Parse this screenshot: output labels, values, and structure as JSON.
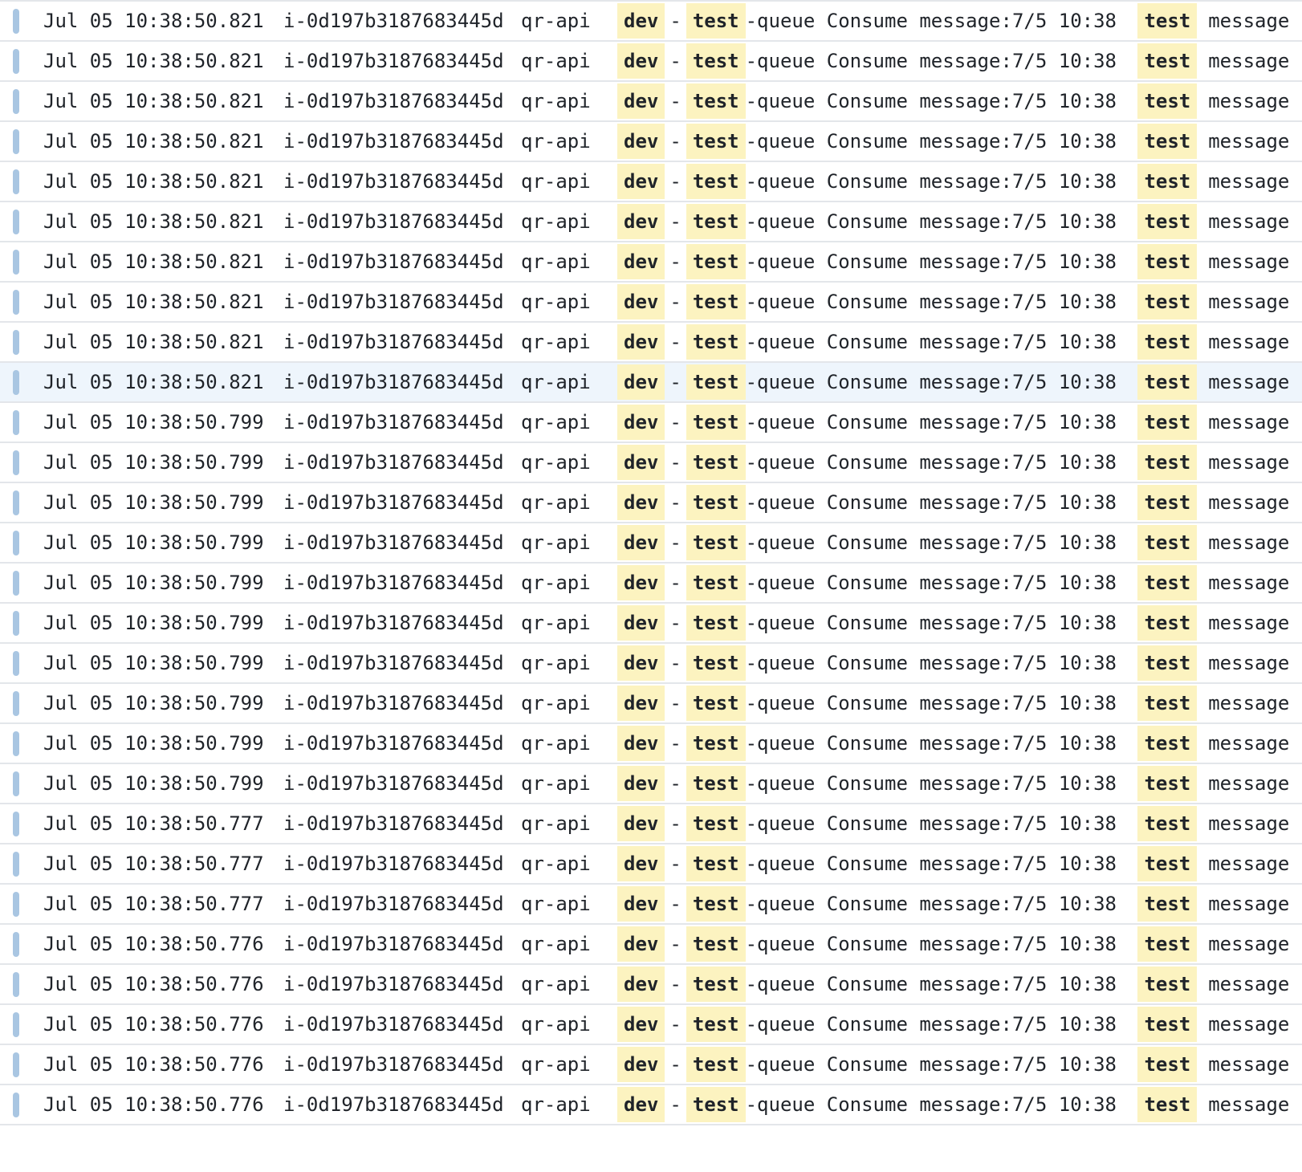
{
  "colors": {
    "marker": "#a9c6e2",
    "highlight": "#fcf3c0",
    "selected_row": "#eef5fc",
    "text": "#1f2329",
    "divider": "#e3e6ea"
  },
  "highlight_terms": [
    "dev",
    "test"
  ],
  "selected_index": 9,
  "logs": [
    {
      "time": "Jul 05 10:38:50.821",
      "instance": "i-0d197b3187683445d",
      "service": "qr-api",
      "message": "dev-test-queue Consume message:7/5 10:38 test message"
    },
    {
      "time": "Jul 05 10:38:50.821",
      "instance": "i-0d197b3187683445d",
      "service": "qr-api",
      "message": "dev-test-queue Consume message:7/5 10:38 test message"
    },
    {
      "time": "Jul 05 10:38:50.821",
      "instance": "i-0d197b3187683445d",
      "service": "qr-api",
      "message": "dev-test-queue Consume message:7/5 10:38 test message"
    },
    {
      "time": "Jul 05 10:38:50.821",
      "instance": "i-0d197b3187683445d",
      "service": "qr-api",
      "message": "dev-test-queue Consume message:7/5 10:38 test message"
    },
    {
      "time": "Jul 05 10:38:50.821",
      "instance": "i-0d197b3187683445d",
      "service": "qr-api",
      "message": "dev-test-queue Consume message:7/5 10:38 test message"
    },
    {
      "time": "Jul 05 10:38:50.821",
      "instance": "i-0d197b3187683445d",
      "service": "qr-api",
      "message": "dev-test-queue Consume message:7/5 10:38 test message"
    },
    {
      "time": "Jul 05 10:38:50.821",
      "instance": "i-0d197b3187683445d",
      "service": "qr-api",
      "message": "dev-test-queue Consume message:7/5 10:38 test message"
    },
    {
      "time": "Jul 05 10:38:50.821",
      "instance": "i-0d197b3187683445d",
      "service": "qr-api",
      "message": "dev-test-queue Consume message:7/5 10:38 test message"
    },
    {
      "time": "Jul 05 10:38:50.821",
      "instance": "i-0d197b3187683445d",
      "service": "qr-api",
      "message": "dev-test-queue Consume message:7/5 10:38 test message"
    },
    {
      "time": "Jul 05 10:38:50.821",
      "instance": "i-0d197b3187683445d",
      "service": "qr-api",
      "message": "dev-test-queue Consume message:7/5 10:38 test message"
    },
    {
      "time": "Jul 05 10:38:50.799",
      "instance": "i-0d197b3187683445d",
      "service": "qr-api",
      "message": "dev-test-queue Consume message:7/5 10:38 test message"
    },
    {
      "time": "Jul 05 10:38:50.799",
      "instance": "i-0d197b3187683445d",
      "service": "qr-api",
      "message": "dev-test-queue Consume message:7/5 10:38 test message"
    },
    {
      "time": "Jul 05 10:38:50.799",
      "instance": "i-0d197b3187683445d",
      "service": "qr-api",
      "message": "dev-test-queue Consume message:7/5 10:38 test message"
    },
    {
      "time": "Jul 05 10:38:50.799",
      "instance": "i-0d197b3187683445d",
      "service": "qr-api",
      "message": "dev-test-queue Consume message:7/5 10:38 test message"
    },
    {
      "time": "Jul 05 10:38:50.799",
      "instance": "i-0d197b3187683445d",
      "service": "qr-api",
      "message": "dev-test-queue Consume message:7/5 10:38 test message"
    },
    {
      "time": "Jul 05 10:38:50.799",
      "instance": "i-0d197b3187683445d",
      "service": "qr-api",
      "message": "dev-test-queue Consume message:7/5 10:38 test message"
    },
    {
      "time": "Jul 05 10:38:50.799",
      "instance": "i-0d197b3187683445d",
      "service": "qr-api",
      "message": "dev-test-queue Consume message:7/5 10:38 test message"
    },
    {
      "time": "Jul 05 10:38:50.799",
      "instance": "i-0d197b3187683445d",
      "service": "qr-api",
      "message": "dev-test-queue Consume message:7/5 10:38 test message"
    },
    {
      "time": "Jul 05 10:38:50.799",
      "instance": "i-0d197b3187683445d",
      "service": "qr-api",
      "message": "dev-test-queue Consume message:7/5 10:38 test message"
    },
    {
      "time": "Jul 05 10:38:50.799",
      "instance": "i-0d197b3187683445d",
      "service": "qr-api",
      "message": "dev-test-queue Consume message:7/5 10:38 test message"
    },
    {
      "time": "Jul 05 10:38:50.777",
      "instance": "i-0d197b3187683445d",
      "service": "qr-api",
      "message": "dev-test-queue Consume message:7/5 10:38 test message"
    },
    {
      "time": "Jul 05 10:38:50.777",
      "instance": "i-0d197b3187683445d",
      "service": "qr-api",
      "message": "dev-test-queue Consume message:7/5 10:38 test message"
    },
    {
      "time": "Jul 05 10:38:50.777",
      "instance": "i-0d197b3187683445d",
      "service": "qr-api",
      "message": "dev-test-queue Consume message:7/5 10:38 test message"
    },
    {
      "time": "Jul 05 10:38:50.776",
      "instance": "i-0d197b3187683445d",
      "service": "qr-api",
      "message": "dev-test-queue Consume message:7/5 10:38 test message"
    },
    {
      "time": "Jul 05 10:38:50.776",
      "instance": "i-0d197b3187683445d",
      "service": "qr-api",
      "message": "dev-test-queue Consume message:7/5 10:38 test message"
    },
    {
      "time": "Jul 05 10:38:50.776",
      "instance": "i-0d197b3187683445d",
      "service": "qr-api",
      "message": "dev-test-queue Consume message:7/5 10:38 test message"
    },
    {
      "time": "Jul 05 10:38:50.776",
      "instance": "i-0d197b3187683445d",
      "service": "qr-api",
      "message": "dev-test-queue Consume message:7/5 10:38 test message"
    },
    {
      "time": "Jul 05 10:38:50.776",
      "instance": "i-0d197b3187683445d",
      "service": "qr-api",
      "message": "dev-test-queue Consume message:7/5 10:38 test message"
    }
  ]
}
